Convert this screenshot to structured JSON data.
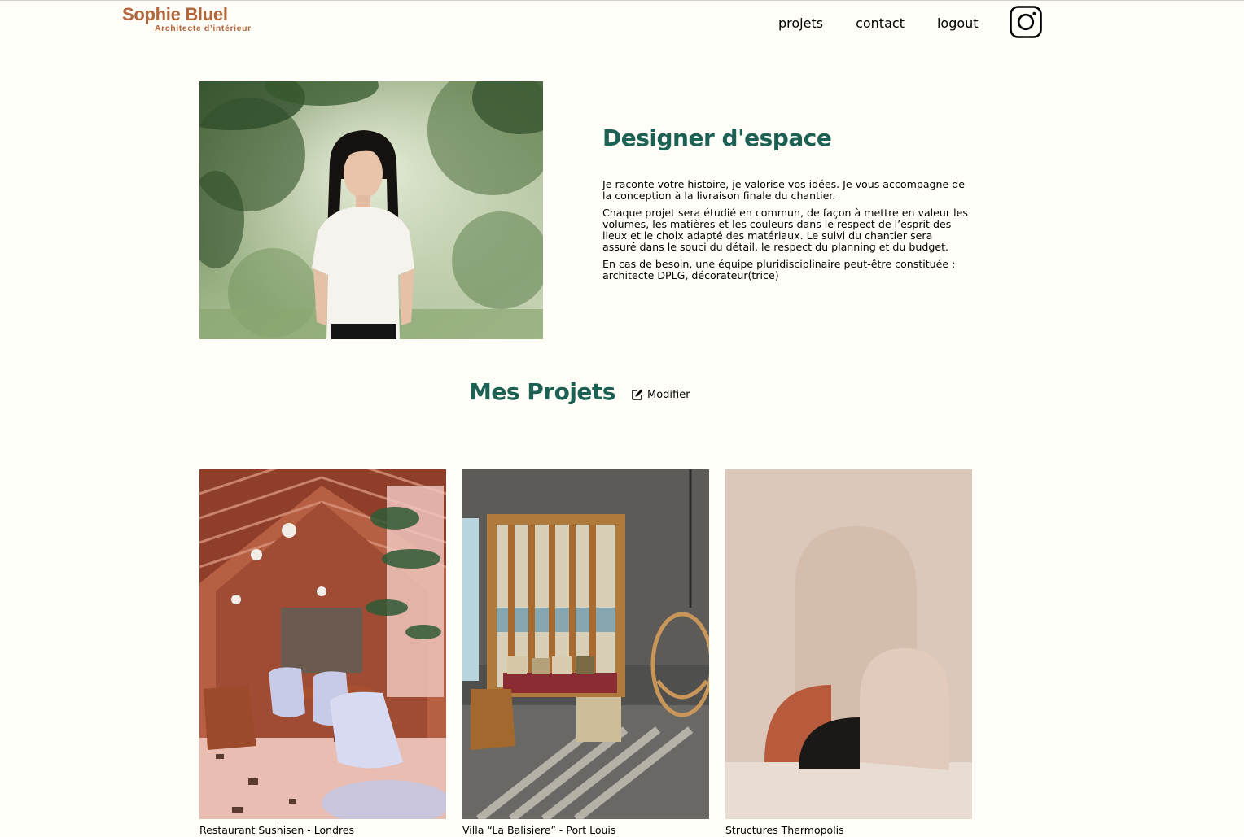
{
  "brand": {
    "name": "Sophie Bluel",
    "subtitle": "Architecte d’intérieur",
    "color": "#b1663c"
  },
  "nav": {
    "items": [
      {
        "label": "projets"
      },
      {
        "label": "contact"
      },
      {
        "label": "logout"
      }
    ],
    "instagram_icon": "instagram-icon"
  },
  "introduction": {
    "title": "Designer d'espace",
    "paragraphs": [
      "Je raconte votre histoire, je valorise vos idées. Je vous accompagne de la conception à la livraison finale du chantier.",
      "Chaque projet sera étudié en commun, de façon à mettre en valeur les volumes, les matières et les couleurs dans le respect de l’esprit des lieux et le choix adapté des matériaux. Le suivi du chantier sera assuré dans le souci du détail, le respect du planning et du budget.",
      "En cas de besoin, une équipe pluridisciplinaire peut-être constituée : architecte DPLG, décorateur(trice)"
    ],
    "accent_color": "#1d6154"
  },
  "portfolio": {
    "title": "Mes Projets",
    "edit_label": "Modifier",
    "edit_icon": "pen-square-icon",
    "works": [
      {
        "caption": "Restaurant Sushisen - Londres"
      },
      {
        "caption": "Villa “La Balisiere” - Port Louis"
      },
      {
        "caption": "Structures Thermopolis"
      }
    ]
  }
}
